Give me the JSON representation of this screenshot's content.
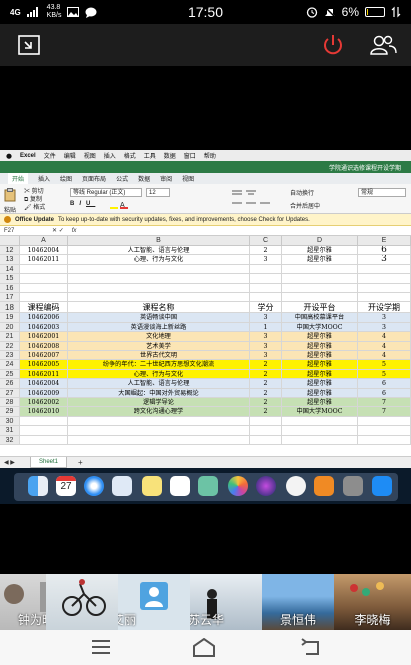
{
  "status": {
    "signal": "4G",
    "speed": "43.8",
    "speed_unit": "KB/s",
    "time": "17:50",
    "battery": "6%",
    "battery_level": 0.06
  },
  "excel": {
    "menubar": [
      "Excel",
      "文件",
      "编辑",
      "视图",
      "插入",
      "格式",
      "工具",
      "数据",
      "窗口",
      "帮助"
    ],
    "title": "学院通识选修课程开设学期",
    "tabs": [
      "开始",
      "插入",
      "绘图",
      "页面布局",
      "公式",
      "数据",
      "审阅",
      "视图"
    ],
    "active_tab": "开始",
    "ribbon": {
      "paste": "粘贴",
      "cut": "剪切",
      "copy": "复制",
      "format": "格式",
      "font_name": "等线 Regular (正文)",
      "font_size": "12",
      "wrap": "自动换行",
      "merge": "合并后居中",
      "number_format": "常规"
    },
    "update": {
      "title": "Office Update",
      "message": "To keep up-to-date with security updates, fixes, and improvements, choose Check for Updates."
    },
    "namebox": "F27",
    "fx": "fx",
    "col_headers": [
      "A",
      "B",
      "C",
      "D",
      "E"
    ],
    "top_rows": [
      {
        "n": "12",
        "a": "10462004",
        "b": "人工智能、语言与伦理",
        "c": "2",
        "d": "超星尔雅",
        "e": "6"
      },
      {
        "n": "13",
        "a": "10462011",
        "b": "心理、行为与文化",
        "c": "3",
        "d": "超星尔雅",
        "e": "3"
      }
    ],
    "blank_rows": [
      "14",
      "15",
      "16",
      "17"
    ],
    "header_row": {
      "n": "18",
      "a": "课程编码",
      "b": "课程名称",
      "c": "学分",
      "d": "开设平台",
      "e": "开设学期"
    },
    "rows": [
      {
        "n": "19",
        "a": "10462006",
        "b": "英语畅谈中国",
        "c": "3",
        "d": "中国高校慕课平台",
        "e": "3",
        "fill": "#dbe6f3"
      },
      {
        "n": "20",
        "a": "10462003",
        "b": "英语漫谈海上新丝路",
        "c": "1",
        "d": "中国大学MOOC",
        "e": "3",
        "fill": "#dbe6f3"
      },
      {
        "n": "21",
        "a": "10462001",
        "b": "文化地理",
        "c": "3",
        "d": "超星尔雅",
        "e": "4",
        "fill": "#fbe5b5"
      },
      {
        "n": "22",
        "a": "10462008",
        "b": "艺术美学",
        "c": "3",
        "d": "超星尔雅",
        "e": "4",
        "fill": "#fbe5b5"
      },
      {
        "n": "23",
        "a": "10462007",
        "b": "世界古代文明",
        "c": "3",
        "d": "超星尔雅",
        "e": "4",
        "fill": "#fbe5b5"
      },
      {
        "n": "24",
        "a": "10462005",
        "b": "纷争的年代：二十世纪西方思想文化潮流",
        "c": "2",
        "d": "超星尔雅",
        "e": "5",
        "fill": "#fff200"
      },
      {
        "n": "25",
        "a": "10462011",
        "b": "心理、行为与文化",
        "c": "2",
        "d": "超星尔雅",
        "e": "5",
        "fill": "#fff200"
      },
      {
        "n": "26",
        "a": "10462004",
        "b": "人工智能、语言与伦理",
        "c": "2",
        "d": "超星尔雅",
        "e": "6",
        "fill": "#dbe6f3"
      },
      {
        "n": "27",
        "a": "10462009",
        "b": "大国崛起：中国对外贸易概论",
        "c": "2",
        "d": "超星尔雅",
        "e": "6",
        "fill": "#dbe6f3"
      },
      {
        "n": "28",
        "a": "10462002",
        "b": "逻辑学导论",
        "c": "2",
        "d": "超星尔雅",
        "e": "7",
        "fill": "#c6e0b4"
      },
      {
        "n": "29",
        "a": "10462010",
        "b": "跨文化沟通心理学",
        "c": "2",
        "d": "中国大学MOOC",
        "e": "7",
        "fill": "#c6e0b4"
      }
    ],
    "tail_rows": [
      "30",
      "31",
      "32"
    ],
    "sheet_tab": "Sheet1",
    "add_sheet": "+"
  },
  "dock": {
    "calendar_day": "27",
    "apps": [
      "finder-icon",
      "calendar-icon",
      "safari-icon",
      "mail-icon",
      "notes-icon",
      "reminders-icon",
      "preview-icon",
      "photos-icon",
      "siri-icon",
      "music-icon",
      "books-icon",
      "system-preferences-icon",
      "app-store-icon"
    ]
  },
  "participants": [
    {
      "name": "钟为晓"
    },
    {
      "name": "艾丽"
    },
    {
      "name": "苏云华"
    },
    {
      "name": "景恒伟"
    },
    {
      "name": "李晓梅"
    }
  ],
  "colors": {
    "excel_green": "#2c7a45",
    "leave_red": "#e53935",
    "blue_row": "#dbe6f3",
    "orange_row": "#fbe5b5",
    "yellow_row": "#fff200",
    "green_row": "#c6e0b4"
  }
}
